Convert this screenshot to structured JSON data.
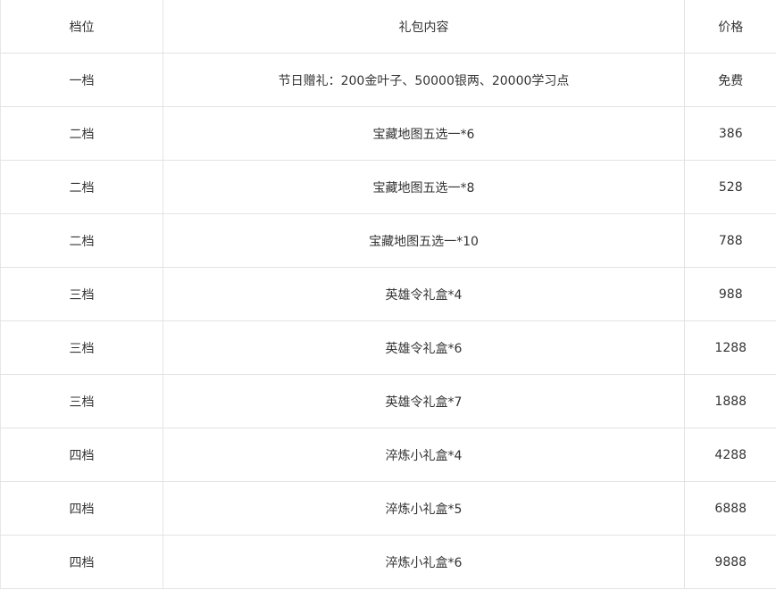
{
  "table": {
    "headers": {
      "tier": "档位",
      "content": "礼包内容",
      "price": "价格"
    },
    "rows": [
      {
        "tier": "一档",
        "content": "节日赠礼：200金叶子、50000银两、20000学习点",
        "price": "免费"
      },
      {
        "tier": "二档",
        "content": "宝藏地图五选一*6",
        "price": "386"
      },
      {
        "tier": "二档",
        "content": "宝藏地图五选一*8",
        "price": "528"
      },
      {
        "tier": "二档",
        "content": "宝藏地图五选一*10",
        "price": "788"
      },
      {
        "tier": "三档",
        "content": "英雄令礼盒*4",
        "price": "988"
      },
      {
        "tier": "三档",
        "content": "英雄令礼盒*6",
        "price": "1288"
      },
      {
        "tier": "三档",
        "content": "英雄令礼盒*7",
        "price": "1888"
      },
      {
        "tier": "四档",
        "content": "淬炼小礼盒*4",
        "price": "4288"
      },
      {
        "tier": "四档",
        "content": "淬炼小礼盒*5",
        "price": "6888"
      },
      {
        "tier": "四档",
        "content": "淬炼小礼盒*6",
        "price": "9888"
      }
    ]
  },
  "colors": {
    "text": "#333333",
    "border": "#e3e3e3",
    "background": "#ffffff"
  }
}
